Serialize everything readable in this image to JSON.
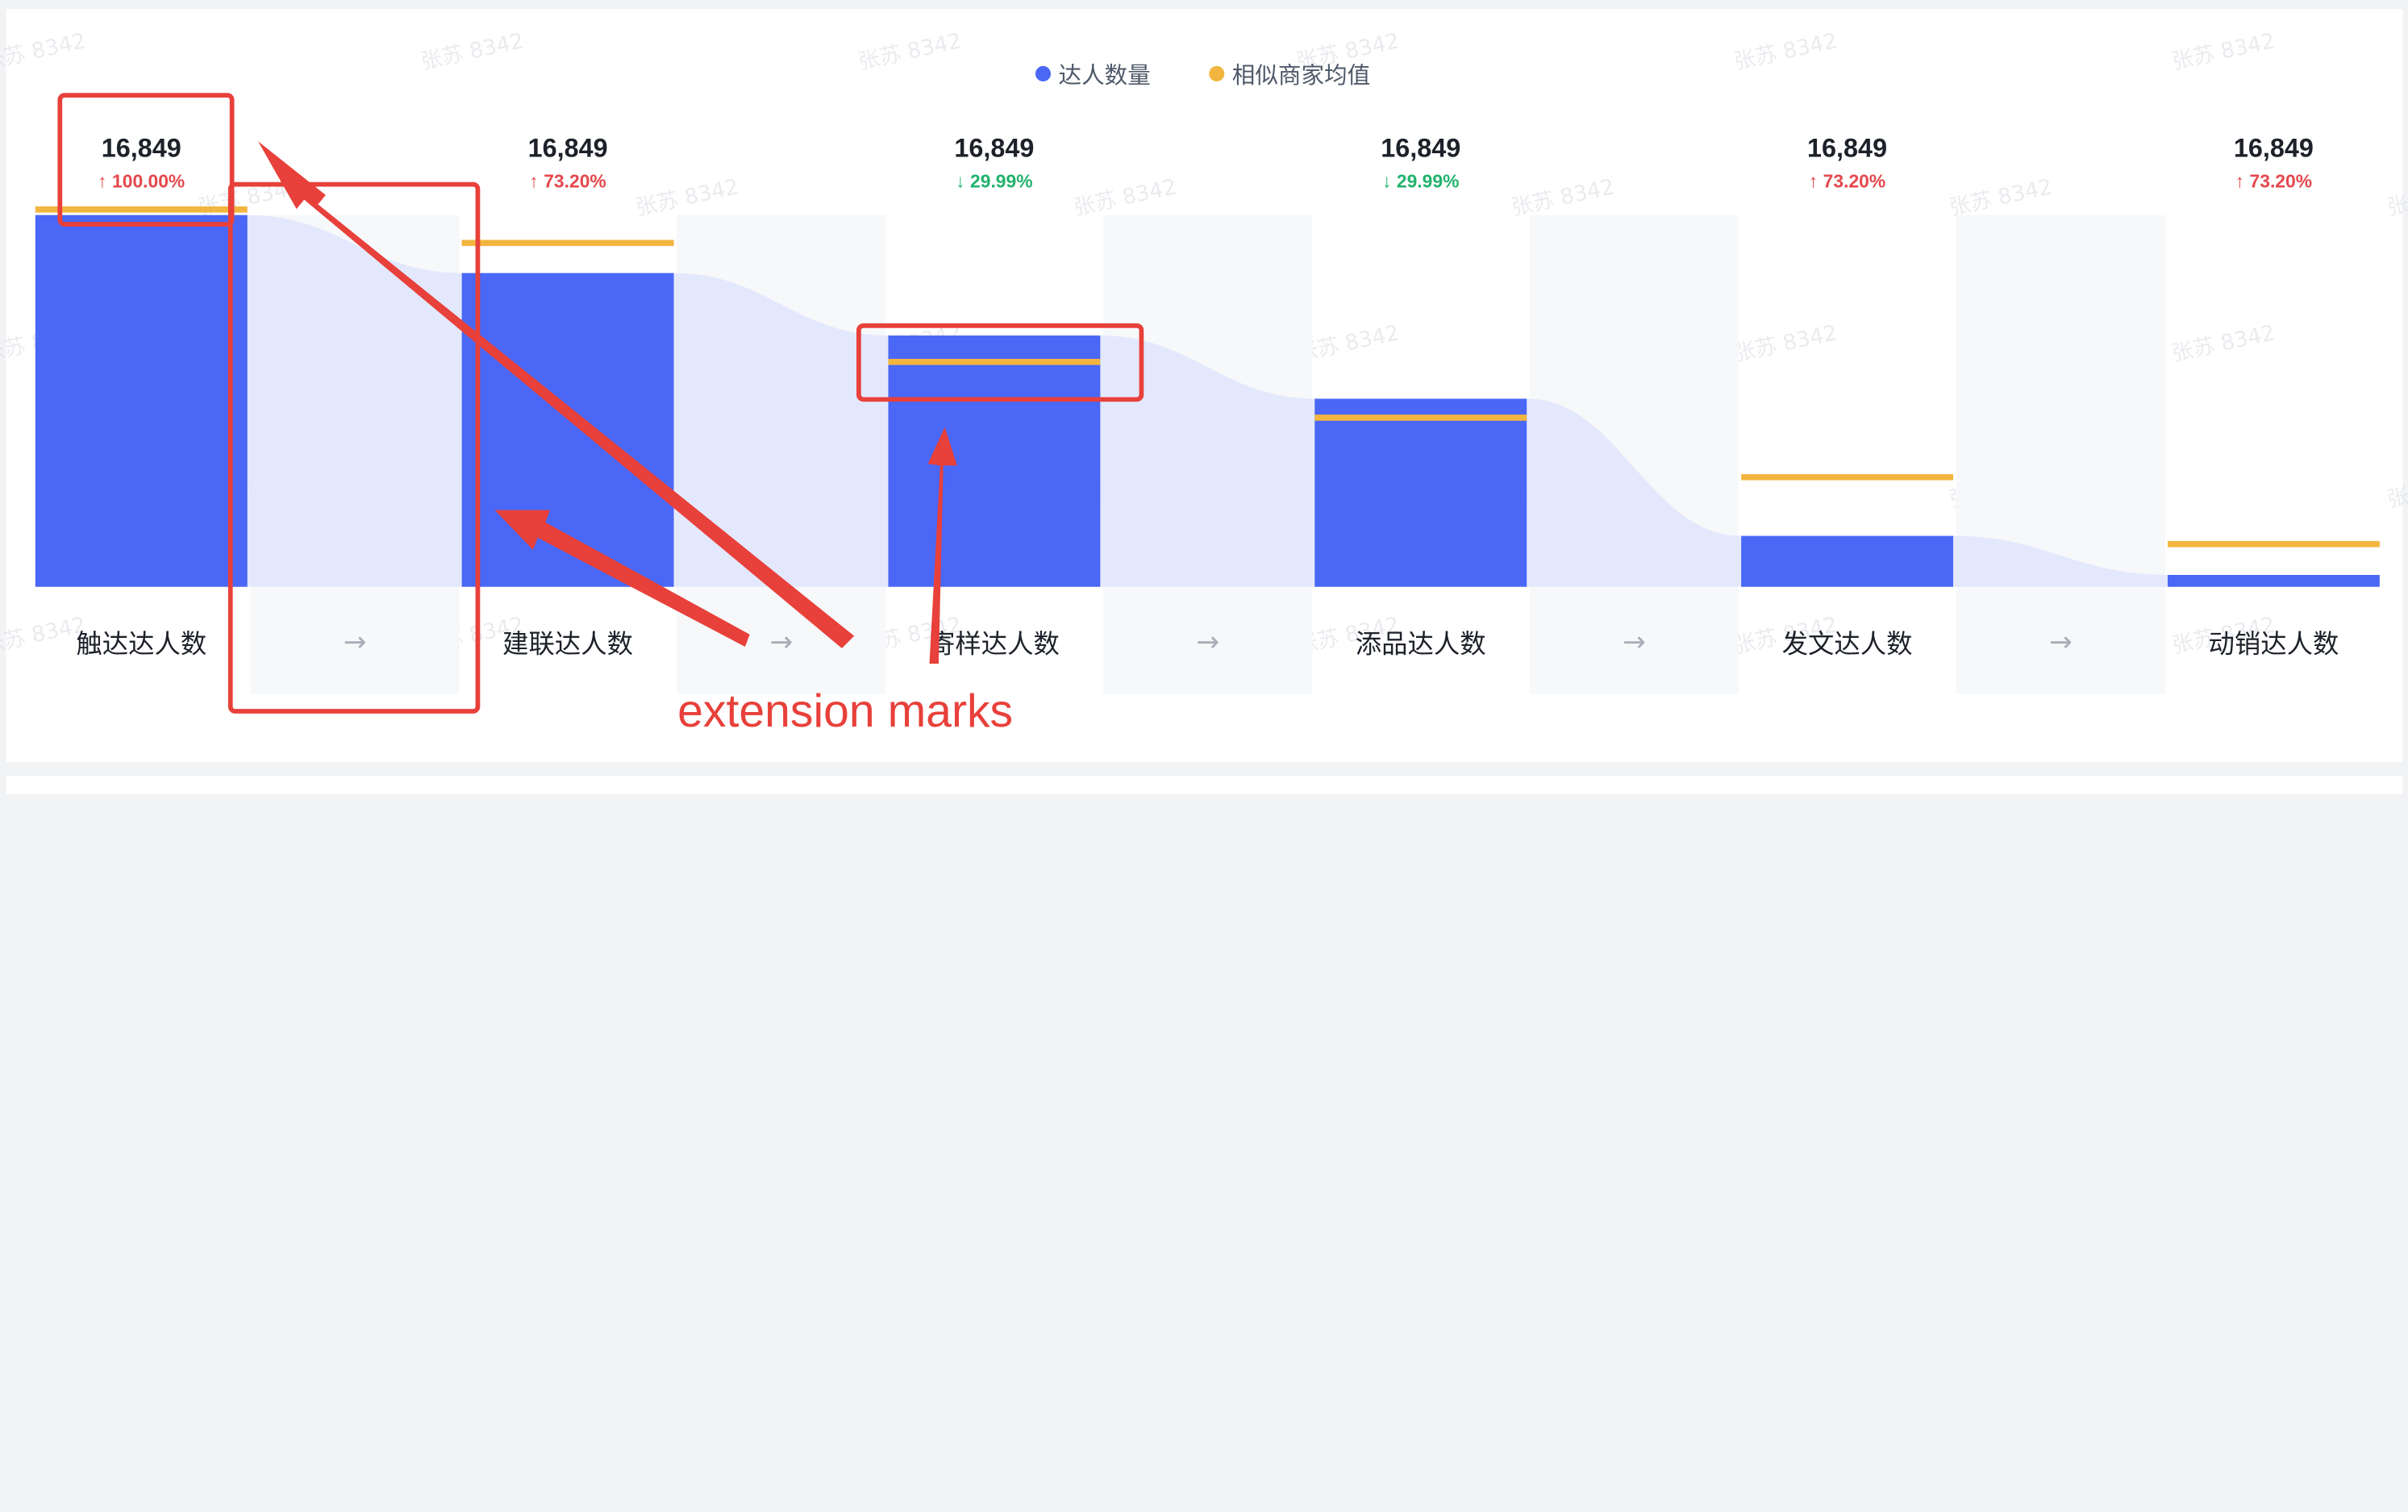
{
  "chart_data": {
    "type": "bar",
    "legend": [
      {
        "name": "达人数量",
        "color": "#4a67f5"
      },
      {
        "name": "相似商家均值",
        "color": "#f2b53f"
      }
    ],
    "categories": [
      "触达达人数",
      "建联达人数",
      "寄样达人数",
      "添品达人数",
      "发文达人数",
      "动销达人数"
    ],
    "series": [
      {
        "name": "达人数量",
        "values": [
          100,
          84.4,
          67.6,
          50.6,
          13.7,
          3.2
        ]
      },
      {
        "name": "相似商家均值",
        "values": [
          101.5,
          92.5,
          60.5,
          45.5,
          29.5,
          11.5
        ]
      }
    ],
    "value_labels": [
      "16,849",
      "16,849",
      "16,849",
      "16,849",
      "16,849",
      "16,849"
    ],
    "rate_labels": [
      {
        "dir": "up",
        "text": "100.00%"
      },
      {
        "dir": "up",
        "text": "73.20%"
      },
      {
        "dir": "down",
        "text": "29.99%"
      },
      {
        "dir": "down",
        "text": "29.99%"
      },
      {
        "dir": "up",
        "text": "73.20%"
      },
      {
        "dir": "up",
        "text": "73.20%"
      }
    ],
    "arrow_glyph": "→",
    "ylim": [
      0,
      100
    ],
    "grid": false,
    "legend_position": "top-center",
    "colors": {
      "bar": "#4a67f5",
      "mean_line": "#f2b53f",
      "flow": "#dfe5fb",
      "up": "#e5484d",
      "down": "#23b26d",
      "annotation": "#e8403a"
    }
  },
  "annotation": {
    "text": "extension marks"
  },
  "watermark": {
    "text": "张苏 8342"
  }
}
